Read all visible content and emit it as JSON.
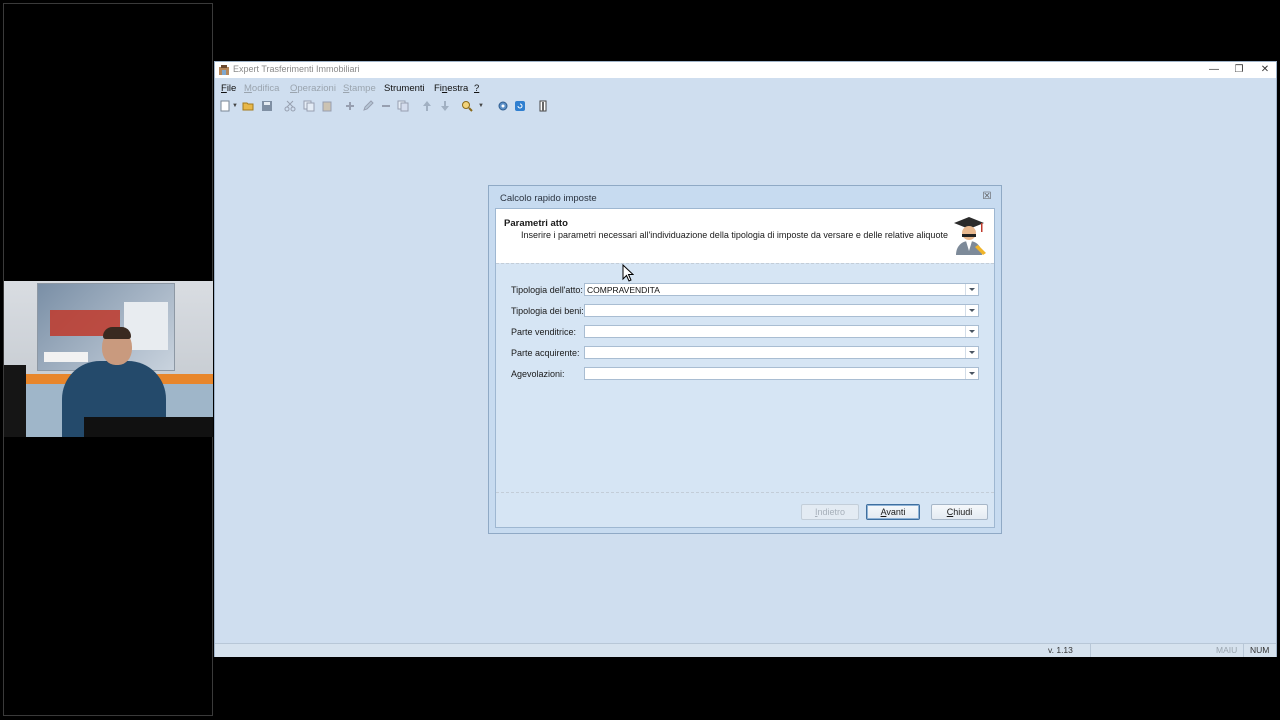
{
  "window": {
    "title": "Expert Trasferimenti Immobiliari",
    "controls": [
      "minimize-icon",
      "restore-icon",
      "close-icon"
    ]
  },
  "menu": {
    "items": [
      {
        "pre": "",
        "ul": "F",
        "post": "ile",
        "enabled": true
      },
      {
        "pre": "",
        "ul": "M",
        "post": "odifica",
        "enabled": false
      },
      {
        "pre": "",
        "ul": "O",
        "post": "perazioni",
        "enabled": false
      },
      {
        "pre": "",
        "ul": "S",
        "post": "tampe",
        "enabled": false
      },
      {
        "pre": "Strumenti",
        "ul": "",
        "post": "",
        "enabled": true
      },
      {
        "pre": "Fi",
        "ul": "n",
        "post": "estra",
        "enabled": true
      },
      {
        "pre": "",
        "ul": "?",
        "post": "",
        "enabled": true
      }
    ]
  },
  "toolbar": {
    "icons": [
      "new-document-icon",
      "open-folder-icon",
      "save-icon",
      "cut-icon",
      "copy-icon",
      "paste-icon",
      "add-icon",
      "edit-icon",
      "remove-icon",
      "duplicate-icon",
      "move-up-icon",
      "move-down-icon",
      "search-icon",
      "settings-icon",
      "refresh-icon",
      "exit-door-icon"
    ]
  },
  "dialog": {
    "title": "Calcolo rapido imposte",
    "header_title": "Parametri atto",
    "header_subtitle": "Inserire i parametri necessari all'individuazione della tipologia di imposte da versare e delle relative aliquote",
    "fields": [
      {
        "label": "Tipologia dell'atto:",
        "value": "COMPRAVENDITA"
      },
      {
        "label": "Tipologia dei beni:",
        "value": ""
      },
      {
        "label": "Parte venditrice:",
        "value": ""
      },
      {
        "label": "Parte acquirente:",
        "value": ""
      },
      {
        "label": "Agevolazioni:",
        "value": ""
      }
    ],
    "buttons": {
      "back": {
        "ul": "I",
        "rest": "ndietro",
        "enabled": false
      },
      "next": {
        "ul": "A",
        "rest": "vanti",
        "enabled": true
      },
      "close": {
        "ul": "C",
        "rest": "hiudi",
        "enabled": true
      }
    }
  },
  "statusbar": {
    "version": "v. 1.13",
    "caps": "MAIU",
    "num": "NUM"
  }
}
